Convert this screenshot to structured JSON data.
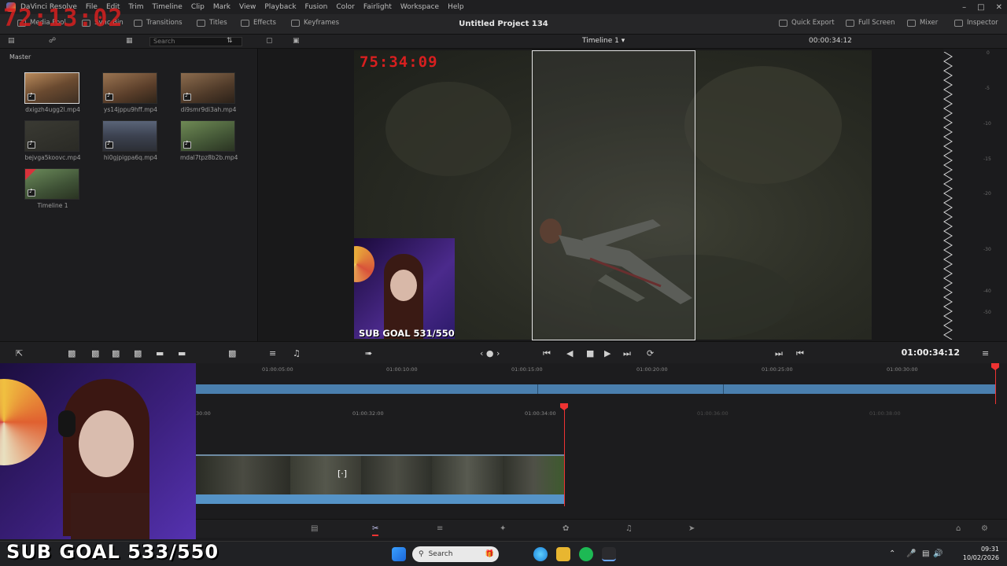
{
  "menu": [
    "DaVinci Resolve",
    "File",
    "Edit",
    "Trim",
    "Timeline",
    "Clip",
    "Mark",
    "View",
    "Playback",
    "Fusion",
    "Color",
    "Fairlight",
    "Workspace",
    "Help"
  ],
  "toolbar": {
    "media_pool": "Media Pool",
    "sync_bin": "Sync Bin",
    "transitions": "Transitions",
    "titles": "Titles",
    "effects": "Effects",
    "keyframes": "Keyframes",
    "project_title": "Untitled Project 134",
    "quick_export": "Quick Export",
    "full_screen": "Full Screen",
    "mixer": "Mixer",
    "inspector": "Inspector"
  },
  "subbar": {
    "search_placeholder": "Search",
    "timeline_name": "Timeline 1",
    "timecode": "00:00:34:12"
  },
  "media_pool": {
    "bin": "Master",
    "clips": [
      {
        "name": "dxigzh4ugg2l.mp4"
      },
      {
        "name": "ys14jppu9hff.mp4"
      },
      {
        "name": "di9smr9di3ah.mp4"
      },
      {
        "name": "bejvga5koovc.mp4"
      },
      {
        "name": "hi0gjpigpa6q.mp4"
      },
      {
        "name": "mdal7tpz8b2b.mp4"
      },
      {
        "name": "Timeline 1"
      }
    ]
  },
  "overlays": {
    "top_timer": "72:13:02",
    "viewer_timer": "75:34:09",
    "sub_goal_small": "SUB GOAL 531/550",
    "sub_goal_big": "SUB GOAL 533/550"
  },
  "transport": {
    "timecode": "01:00:34:12"
  },
  "ruler_top": [
    "01:00:05:00",
    "01:00:10:00",
    "01:00:15:00",
    "01:00:20:00",
    "01:00:25:00",
    "01:00:30:00"
  ],
  "ruler_bottom": [
    "30:00",
    "01:00:32:00",
    "01:00:34:00",
    "01:00:36:00",
    "01:00:38:00"
  ],
  "meter_ticks": [
    "0",
    "-5",
    "-10",
    "-15",
    "-20",
    "-30",
    "-40",
    "-50"
  ],
  "taskbar": {
    "search": "Search",
    "time": "09:31",
    "date": "10/02/2026"
  }
}
